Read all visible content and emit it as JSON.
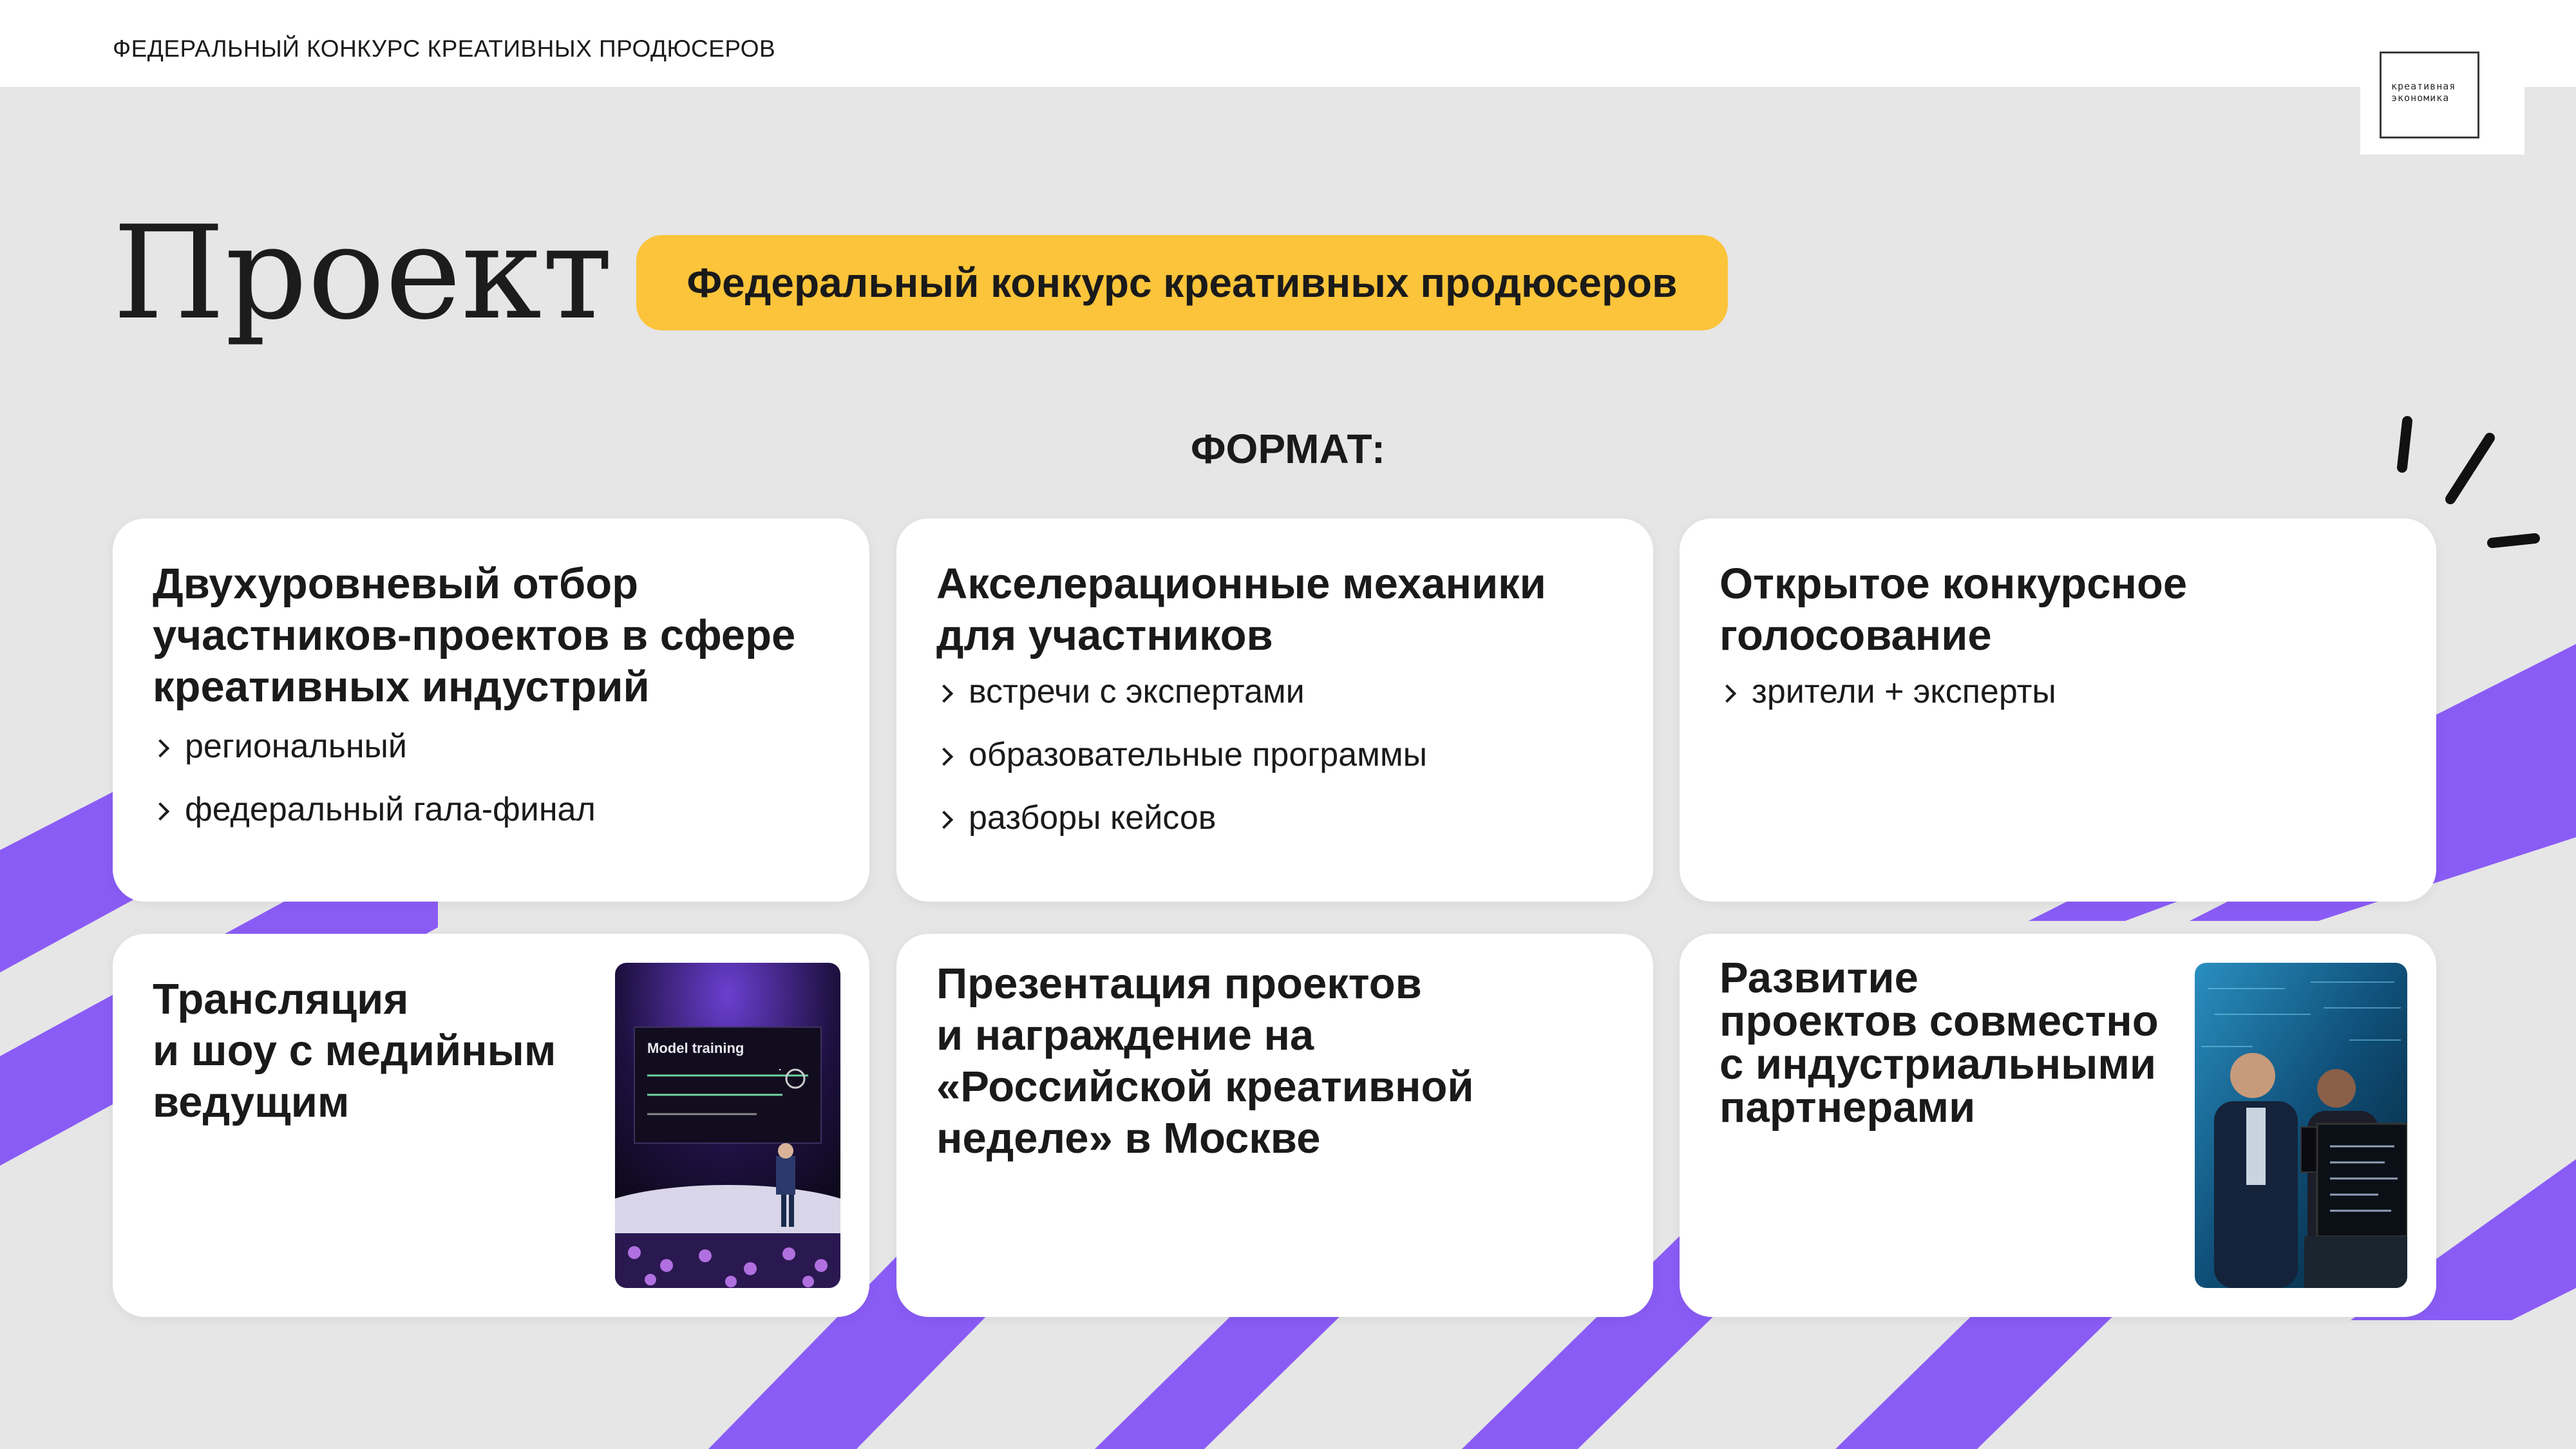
{
  "header": {
    "title": "ФЕДЕРАЛЬНЫЙ КОНКУРС КРЕАТИВНЫХ ПРОДЮСЕРОВ",
    "logo_line1": "креативная",
    "logo_line2": "экономика"
  },
  "page": {
    "title": "Проект",
    "badge": "Федеральный конкурс креативных продюсеров",
    "section_label": "ФОРМАТ:"
  },
  "colors": {
    "background": "#e6e6e6",
    "accent_purple": "#8a5cf6",
    "badge_yellow": "#fbc43a",
    "card": "#ffffff"
  },
  "cards": [
    {
      "title_lines": [
        "Двухуровневый отбор",
        "участников-проектов в сфере",
        "креативных индустрий"
      ],
      "items": [
        "региональный",
        "федеральный гала-финал"
      ]
    },
    {
      "title_lines": [
        "Акселерационные механики",
        "для участников"
      ],
      "items": [
        "встречи с экспертами",
        "образовательные программы",
        "разборы кейсов"
      ]
    },
    {
      "title_lines": [
        "Открытое конкурсное",
        "голосование"
      ],
      "items": [
        "зрители + эксперты"
      ]
    },
    {
      "title_lines": [
        "Трансляция",
        "и шоу с медийным",
        "ведущим"
      ],
      "photo_caption": "Model training"
    },
    {
      "title_lines": [
        "Презентация проектов",
        "и награждение на",
        "«Российской креативной",
        "неделе» в Москве"
      ]
    },
    {
      "title_lines": [
        "Развитие",
        "проектов совместно",
        "с индустриальными",
        "партнерами"
      ]
    }
  ]
}
